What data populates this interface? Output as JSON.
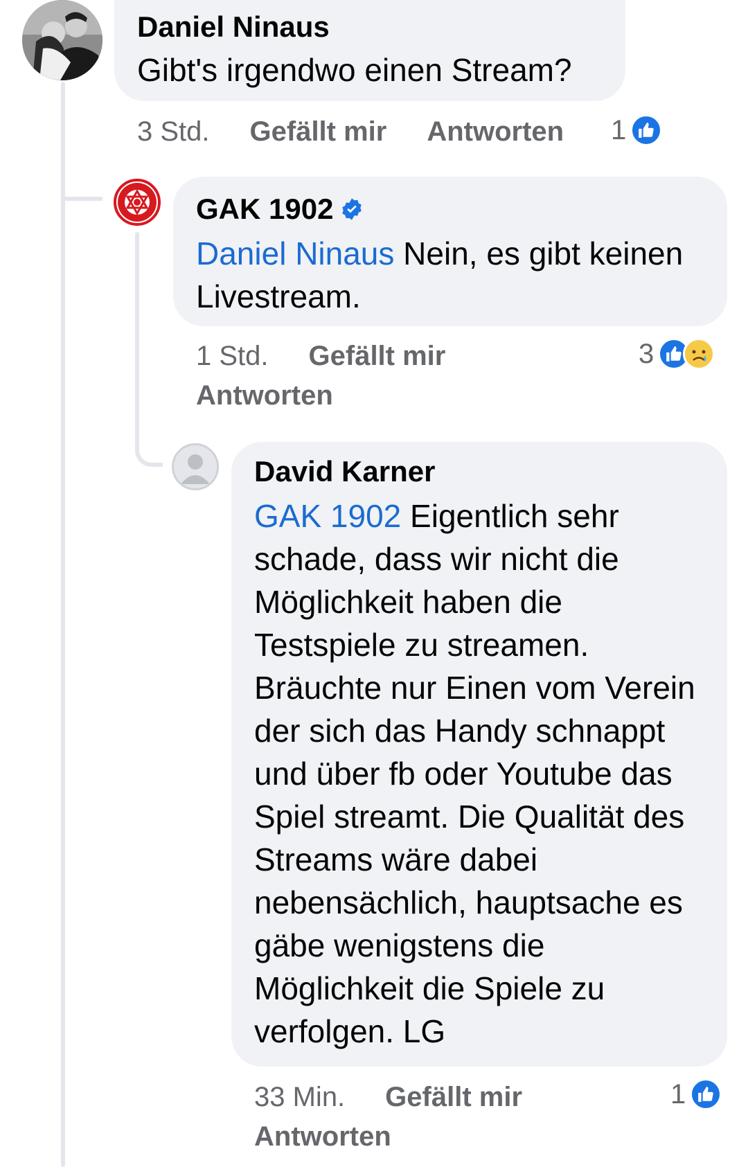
{
  "comments": [
    {
      "author": "Daniel Ninaus",
      "text": "Gibt's irgendwo einen Stream?",
      "time": "3 Std.",
      "like_label": "Gefällt mir",
      "reply_label": "Antworten",
      "reaction_count": "1",
      "reactions": [
        "like"
      ]
    },
    {
      "author": "GAK 1902",
      "verified": true,
      "mention": "Daniel Ninaus",
      "text": " Nein, es gibt keinen Livestream.",
      "time": "1 Std.",
      "like_label": "Gefällt mir",
      "reply_label": "Antworten",
      "reaction_count": "3",
      "reactions": [
        "like",
        "sad"
      ]
    },
    {
      "author": "David Karner",
      "mention": "GAK 1902",
      "text": " Eigentlich sehr schade, dass wir nicht die Möglichkeit haben die Testspiele zu streamen. Bräuchte nur Einen vom Verein der sich das Handy schnappt und über fb oder Youtube das Spiel streamt. Die Qualität des Streams wäre dabei nebensächlich, hauptsache es gäbe wenigstens die Möglichkeit die Spiele zu verfolgen. LG",
      "time": "33 Min.",
      "like_label": "Gefällt mir",
      "reply_label": "Antworten",
      "reaction_count": "1",
      "reactions": [
        "like"
      ]
    }
  ],
  "colors": {
    "bubble": "#f0f2f5",
    "mention": "#1b6bd1",
    "meta": "#65676b",
    "like": "#1b74e4"
  }
}
